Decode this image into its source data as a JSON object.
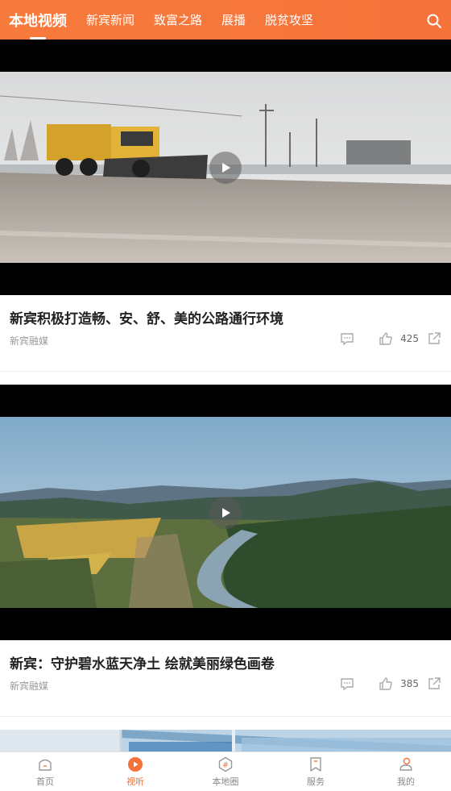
{
  "header": {
    "tabs": [
      {
        "label": "本地视频",
        "active": true
      },
      {
        "label": "新宾新闻",
        "active": false
      },
      {
        "label": "致富之路",
        "active": false
      },
      {
        "label": "展播",
        "active": false
      },
      {
        "label": "脱贫攻坚",
        "active": false
      }
    ],
    "search_icon": "search-icon"
  },
  "feed": {
    "items": [
      {
        "title": "新宾积极打造畅、安、舒、美的公路通行环境",
        "source": "新宾融媒",
        "likes": "425",
        "scene": "road-snowplow"
      },
      {
        "title": "新宾：守护碧水蓝天净土  绘就美丽绿色画卷",
        "source": "新宾融媒",
        "likes": "385",
        "scene": "river-valley"
      }
    ]
  },
  "bottom_nav": {
    "items": [
      {
        "label": "首页",
        "icon": "home-icon",
        "active": false
      },
      {
        "label": "视听",
        "icon": "play-circle-icon",
        "active": true
      },
      {
        "label": "本地圈",
        "icon": "hashtag-icon",
        "active": false
      },
      {
        "label": "服务",
        "icon": "bookmark-icon",
        "active": false
      },
      {
        "label": "我的",
        "icon": "user-icon",
        "active": false
      }
    ]
  },
  "colors": {
    "accent": "#f5723a",
    "text": "#222222",
    "muted": "#999999"
  }
}
